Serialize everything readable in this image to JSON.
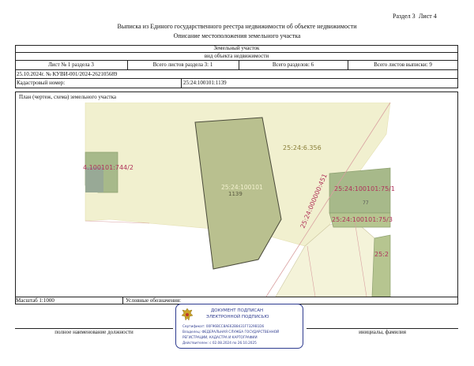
{
  "header": {
    "section_label": "Раздел 3",
    "sheet_label": "Лист 4",
    "title": "Выписка из Единого государственного реестра недвижимости об объекте недвижимости",
    "subtitle": "Описание местоположения земельного участка"
  },
  "info": {
    "object_type": "Земельный участок",
    "object_kind": "вид объекта недвижимости",
    "sheet_of_section": "Лист № 1 раздела 3",
    "section_sheets": "Всего листов раздела 3: 1",
    "total_sections": "Всего разделов: 6",
    "total_sheets": "Всего листов выписки: 9",
    "date_number": "25.10.2024г. № КУВИ-001/2024-262105689",
    "cadastral_label": "Кадастровый номер:",
    "cadastral_value": "25:24:100101:1139"
  },
  "plan": {
    "title": "План (чертеж, схема) земельного участка",
    "scale": "Масштаб 1:1000",
    "legend_label": "Условные обозначения:"
  },
  "map_labels": {
    "left_parcel": "4.100101:744/2",
    "big_parcel": "25:24:6.356",
    "main_parcel_number": "25:24:100101",
    "main_parcel_suffix": "1139",
    "road": "25:24:000000:451",
    "right_1": "25:24:100101:75/1",
    "right_2": "25:24:100101:75/3",
    "right_small": "77",
    "right_3": "25:2"
  },
  "signature": {
    "position_label": "полное наименование должности",
    "name_label": "инициалы, фамилия"
  },
  "stamp": {
    "line1": "ДОКУМЕНТ ПОДПИСАН",
    "line2": "ЭЛЕКТРОННОЙ ПОДПИСЬЮ",
    "cert": "Сертификат: 00F96BCC8AE62B8431F7329B1D6",
    "owner": "Владелец: ФЕДЕРАЛЬНАЯ СЛУЖБА ГОСУДАРСТВЕННОЙ",
    "owner2": "РЕГИСТРАЦИИ, КАДАСТРА И КАРТОГРАФИИ",
    "valid": "Действителен: с 02.08.2024 по 26.10.2025"
  },
  "colors": {
    "background_parcel": "#f1f0cf",
    "main_parcel": "#b9c08f",
    "neighbor_parcel": "#a7b98a",
    "boundary_line": "#d9a0a0",
    "stamp_blue": "#2e3b8f"
  }
}
